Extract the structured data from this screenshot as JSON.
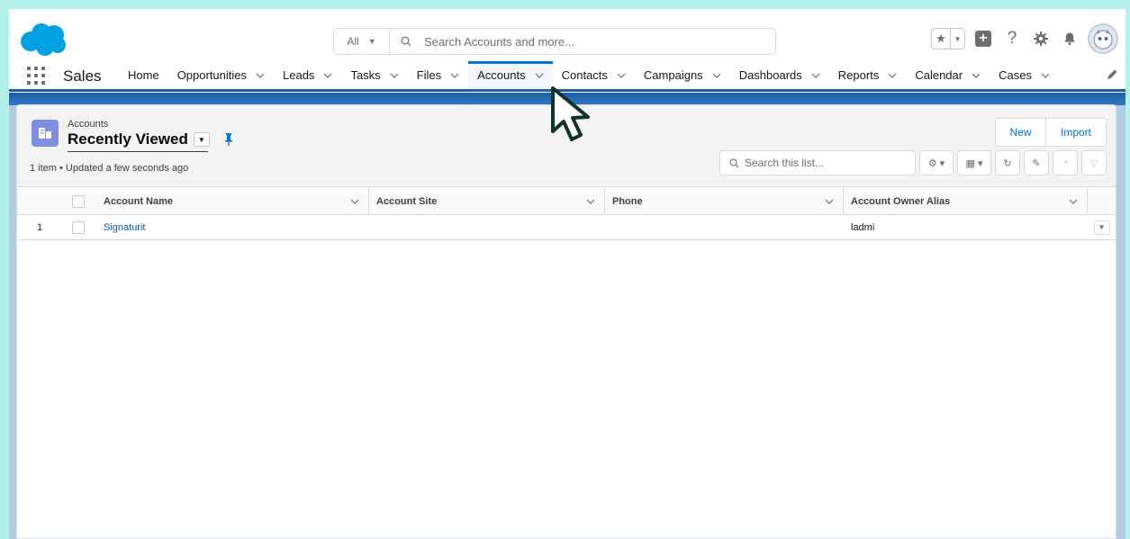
{
  "colors": {
    "outer_border": "#b3f0ea",
    "brand_blue": "#0176d3",
    "header_band": "#1b5fa8",
    "link": "#0b5cab",
    "object_icon": "#7f8de1",
    "salesforce_cloud": "#00a1e0"
  },
  "header": {
    "logo_icon": "salesforce-cloud-logo",
    "search": {
      "scope_label": "All",
      "placeholder": "Search Accounts and more..."
    },
    "icons": [
      "star-favorites-icon",
      "chevron-down-icon",
      "add-icon",
      "help-icon",
      "settings-gear-icon",
      "notifications-bell-icon",
      "user-avatar"
    ]
  },
  "app_nav": {
    "app_name": "Sales",
    "items": [
      {
        "label": "Home",
        "has_menu": false
      },
      {
        "label": "Opportunities",
        "has_menu": true
      },
      {
        "label": "Leads",
        "has_menu": true
      },
      {
        "label": "Tasks",
        "has_menu": true
      },
      {
        "label": "Files",
        "has_menu": true
      },
      {
        "label": "Accounts",
        "has_menu": true,
        "active": true
      },
      {
        "label": "Contacts",
        "has_menu": true
      },
      {
        "label": "Campaigns",
        "has_menu": true
      },
      {
        "label": "Dashboards",
        "has_menu": true
      },
      {
        "label": "Reports",
        "has_menu": true
      },
      {
        "label": "Calendar",
        "has_menu": true
      },
      {
        "label": "Cases",
        "has_menu": true
      }
    ]
  },
  "list_view": {
    "object_label": "Accounts",
    "view_name": "Recently Viewed",
    "meta": "1 item • Updated a few seconds ago",
    "buttons": {
      "new_label": "New",
      "import_label": "Import"
    },
    "search_placeholder": "Search this list..."
  },
  "table": {
    "columns": [
      {
        "label": "Account Name"
      },
      {
        "label": "Account Site"
      },
      {
        "label": "Phone"
      },
      {
        "label": "Account Owner Alias"
      }
    ],
    "rows": [
      {
        "num": "1",
        "account_name": "Signaturit",
        "account_site": "",
        "phone": "",
        "owner_alias": "ladmi"
      }
    ]
  }
}
